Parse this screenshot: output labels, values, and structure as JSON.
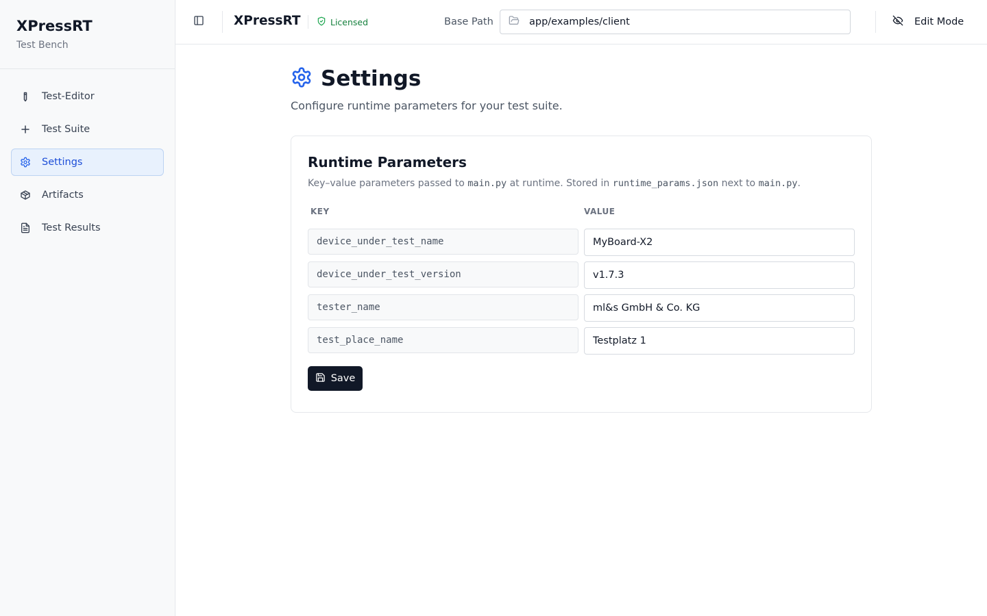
{
  "app": {
    "title": "XPressRT",
    "subtitle": "Test Bench"
  },
  "sidebar": {
    "items": [
      {
        "label": "Test-Editor",
        "icon": "pen-icon",
        "active": false
      },
      {
        "label": "Test Suite",
        "icon": "plus-icon",
        "active": false
      },
      {
        "label": "Settings",
        "icon": "gear-icon",
        "active": true
      },
      {
        "label": "Artifacts",
        "icon": "package-icon",
        "active": false
      },
      {
        "label": "Test Results",
        "icon": "file-text-icon",
        "active": false
      }
    ]
  },
  "header": {
    "title": "XPressRT",
    "license_label": "Licensed",
    "base_path_label": "Base Path",
    "base_path_value": "app/examples/client",
    "edit_mode_label": "Edit Mode"
  },
  "page": {
    "title": "Settings",
    "description": "Configure runtime parameters for your test suite."
  },
  "card": {
    "title": "Runtime Parameters",
    "desc_prefix": "Key–value parameters passed to ",
    "desc_code1": "main.py",
    "desc_mid": " at runtime. Stored in ",
    "desc_code2": "runtime_params.json",
    "desc_mid2": " next to ",
    "desc_code3": "main.py",
    "desc_suffix": ".",
    "col_key": "KEY",
    "col_value": "VALUE",
    "params": [
      {
        "key": "device_under_test_name",
        "value": "MyBoard-X2"
      },
      {
        "key": "device_under_test_version",
        "value": "v1.7.3"
      },
      {
        "key": "tester_name",
        "value": "ml&s GmbH & Co. KG"
      },
      {
        "key": "test_place_name",
        "value": "Testplatz 1"
      }
    ],
    "save_label": "Save"
  },
  "colors": {
    "accent": "#2563eb",
    "active_bg": "#e8f1fd",
    "licensed": "#16a34a",
    "primary_button": "#111827"
  }
}
